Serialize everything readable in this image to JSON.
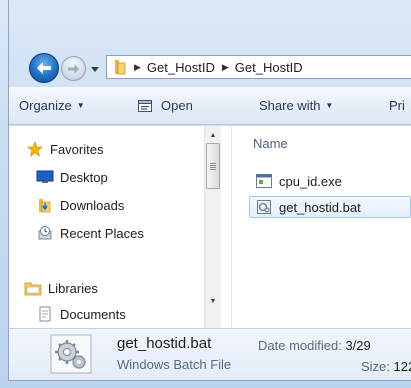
{
  "address": {
    "crumbs": [
      "Get_HostID",
      "Get_HostID"
    ]
  },
  "toolbar": {
    "organize": "Organize",
    "open": "Open",
    "share_with": "Share with",
    "print": "Pri"
  },
  "nav": {
    "favorites": "Favorites",
    "desktop": "Desktop",
    "downloads": "Downloads",
    "recent_places": "Recent Places",
    "libraries": "Libraries",
    "documents": "Documents"
  },
  "files": {
    "column_name": "Name",
    "items": [
      {
        "name": "cpu_id.exe",
        "icon": "exe-icon"
      },
      {
        "name": "get_hostid.bat",
        "icon": "bat-file-icon"
      }
    ]
  },
  "details": {
    "file_name": "get_hostid.bat",
    "file_type": "Windows Batch File",
    "date_modified_label": "Date modified:",
    "date_modified_value": "3/29",
    "size_label": "Size:",
    "size_value": "122"
  },
  "colors": {
    "frame": "#c9dcf1",
    "toolbar_text": "#1e395b",
    "selection_border": "#a7c7ea"
  }
}
